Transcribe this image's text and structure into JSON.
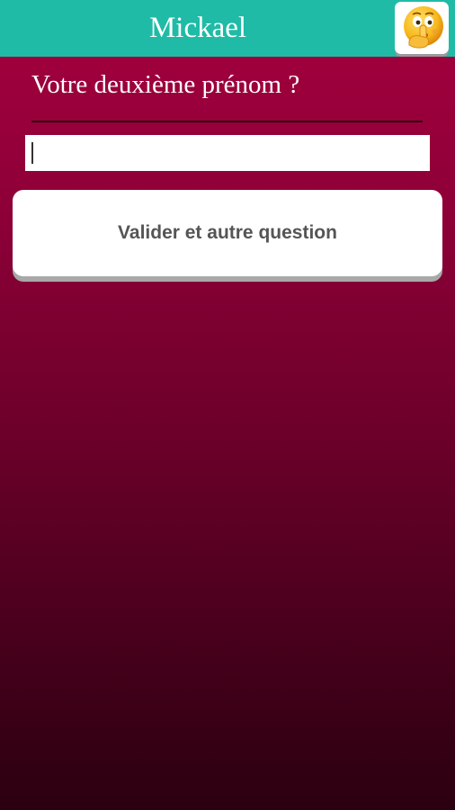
{
  "header": {
    "title": "Mickael",
    "emoji_icon": "shushing-face-icon"
  },
  "form": {
    "question": "Votre deuxième prénom ?",
    "input_value": "",
    "submit_label": "Valider et autre question"
  },
  "colors": {
    "header_bg": "#1fbba6",
    "background_top": "#a5003e",
    "background_bottom": "#2b0010",
    "button_bg": "#ffffff",
    "button_text": "#555555"
  }
}
